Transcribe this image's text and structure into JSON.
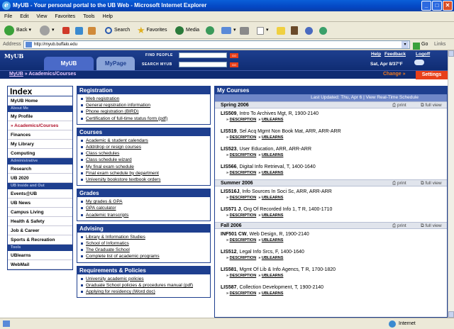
{
  "window": {
    "title": "MyUB - Your personal portal to the UB Web - Microsoft Internet Explorer"
  },
  "menu": [
    "File",
    "Edit",
    "View",
    "Favorites",
    "Tools",
    "Help"
  ],
  "toolbar": {
    "back": "Back",
    "search": "Search",
    "favorites": "Favorites",
    "media": "Media"
  },
  "address": {
    "label": "Address",
    "url": "http://myub.buffalo.edu",
    "go": "Go",
    "links": "Links"
  },
  "header": {
    "logo": "MyUB",
    "tab_myub": "MyUB",
    "tab_mypage": "MyPage",
    "find_people": "FIND PEOPLE",
    "search_myub": "SEARCH MYUB",
    "go": "GO",
    "help": "Help",
    "feedback": "Feedback",
    "logoff": "Logoff",
    "weather": "Sat, Apr 8/37°F"
  },
  "crumb": {
    "home": "MyUB",
    "section": "Academics/Courses",
    "change": "Change »",
    "settings": "Settings"
  },
  "index": {
    "title": "Index",
    "items": [
      {
        "type": "item",
        "label": "MyUB Home"
      },
      {
        "type": "head",
        "label": "About Me"
      },
      {
        "type": "item",
        "label": "My Profile"
      },
      {
        "type": "active",
        "label": "» Academics/Courses"
      },
      {
        "type": "item",
        "label": "Finances"
      },
      {
        "type": "item",
        "label": "My Library"
      },
      {
        "type": "item",
        "label": "Computing"
      },
      {
        "type": "head",
        "label": "Administrative"
      },
      {
        "type": "item",
        "label": "Research"
      },
      {
        "type": "item",
        "label": "UB 2020"
      },
      {
        "type": "head",
        "label": "UB Inside and Out"
      },
      {
        "type": "item",
        "label": "Events@UB"
      },
      {
        "type": "item",
        "label": "UB News"
      },
      {
        "type": "item",
        "label": "Campus Living"
      },
      {
        "type": "item",
        "label": "Health & Safety"
      },
      {
        "type": "item",
        "label": "Job & Career"
      },
      {
        "type": "item",
        "label": "Sports & Recreation"
      },
      {
        "type": "head",
        "label": "Tools"
      },
      {
        "type": "item",
        "label": "UBlearns"
      },
      {
        "type": "item",
        "label": "WebMail"
      }
    ]
  },
  "boxes": [
    {
      "title": "Registration",
      "items": [
        "Web registration",
        "General registration information",
        "Phone registration (BIRD)",
        "Certification of full-time status form (pdf)"
      ]
    },
    {
      "title": "Courses",
      "items": [
        "Academic & student calendars",
        "Add/drop or resign courses",
        "Class schedules",
        "Class schedule wizard",
        "My final exam schedule",
        "Final exam schedule by department",
        "University bookstore textbook orders"
      ]
    },
    {
      "title": "Grades",
      "items": [
        "My grades & GPA",
        "GPA calculator",
        "Academic transcripts"
      ]
    },
    {
      "title": "Advising",
      "items": [
        "Library & Information Studies",
        "School of Informatics",
        "The Graduate School",
        "Complete list of academic programs"
      ]
    },
    {
      "title": "Requirements & Policies",
      "items": [
        "University academic policies",
        "Graduate School policies & procedures manual (pdf)",
        "Applying for residency (Word doc)"
      ]
    }
  ],
  "courses": {
    "title": "My Courses",
    "updated": "Last Updated: Thu, Apr 6 | View Real-Time Schedule",
    "print": "print",
    "full_view": "full view",
    "desc": "DESCRIPTION",
    "ublearns": "UBLEARNS",
    "terms": [
      {
        "name": "Spring 2006",
        "items": [
          {
            "code": "LIS509",
            "desc": ", Intro To Archives Mgt, R, 1900-2140"
          },
          {
            "code": "LIS519",
            "desc": ", Sel Acq Mgmt Non Book Mat, ARR, ARR-ARR"
          },
          {
            "code": "LIS523",
            "desc": ", User Education, ARR, ARR-ARR"
          },
          {
            "code": "LIS566",
            "desc": ", Digital Info Retrieval, T, 1400-1640"
          }
        ]
      },
      {
        "name": "Summer 2006",
        "items": [
          {
            "code": "LIS516J",
            "desc": ", Info Sources In Soci Sc, ARR, ARR-ARR"
          },
          {
            "code": "LIS571 J",
            "desc": ", Org Of Recorded Info 1, T R, 1400-1710"
          }
        ]
      },
      {
        "name": "Fall 2006",
        "items": [
          {
            "code": "INF501 CW",
            "desc": ", Web Design, R, 1900-2140"
          },
          {
            "code": "LIS512",
            "desc": ", Legal Info Srcs, F, 1400-1640"
          },
          {
            "code": "LIS581",
            "desc": ", Mgmt Of Lib & Info Agencs, T R, 1700-1820"
          },
          {
            "code": "LIS587",
            "desc": ", Collection Development, T, 1900-2140"
          }
        ]
      }
    ]
  },
  "status": {
    "zone": "Internet"
  }
}
